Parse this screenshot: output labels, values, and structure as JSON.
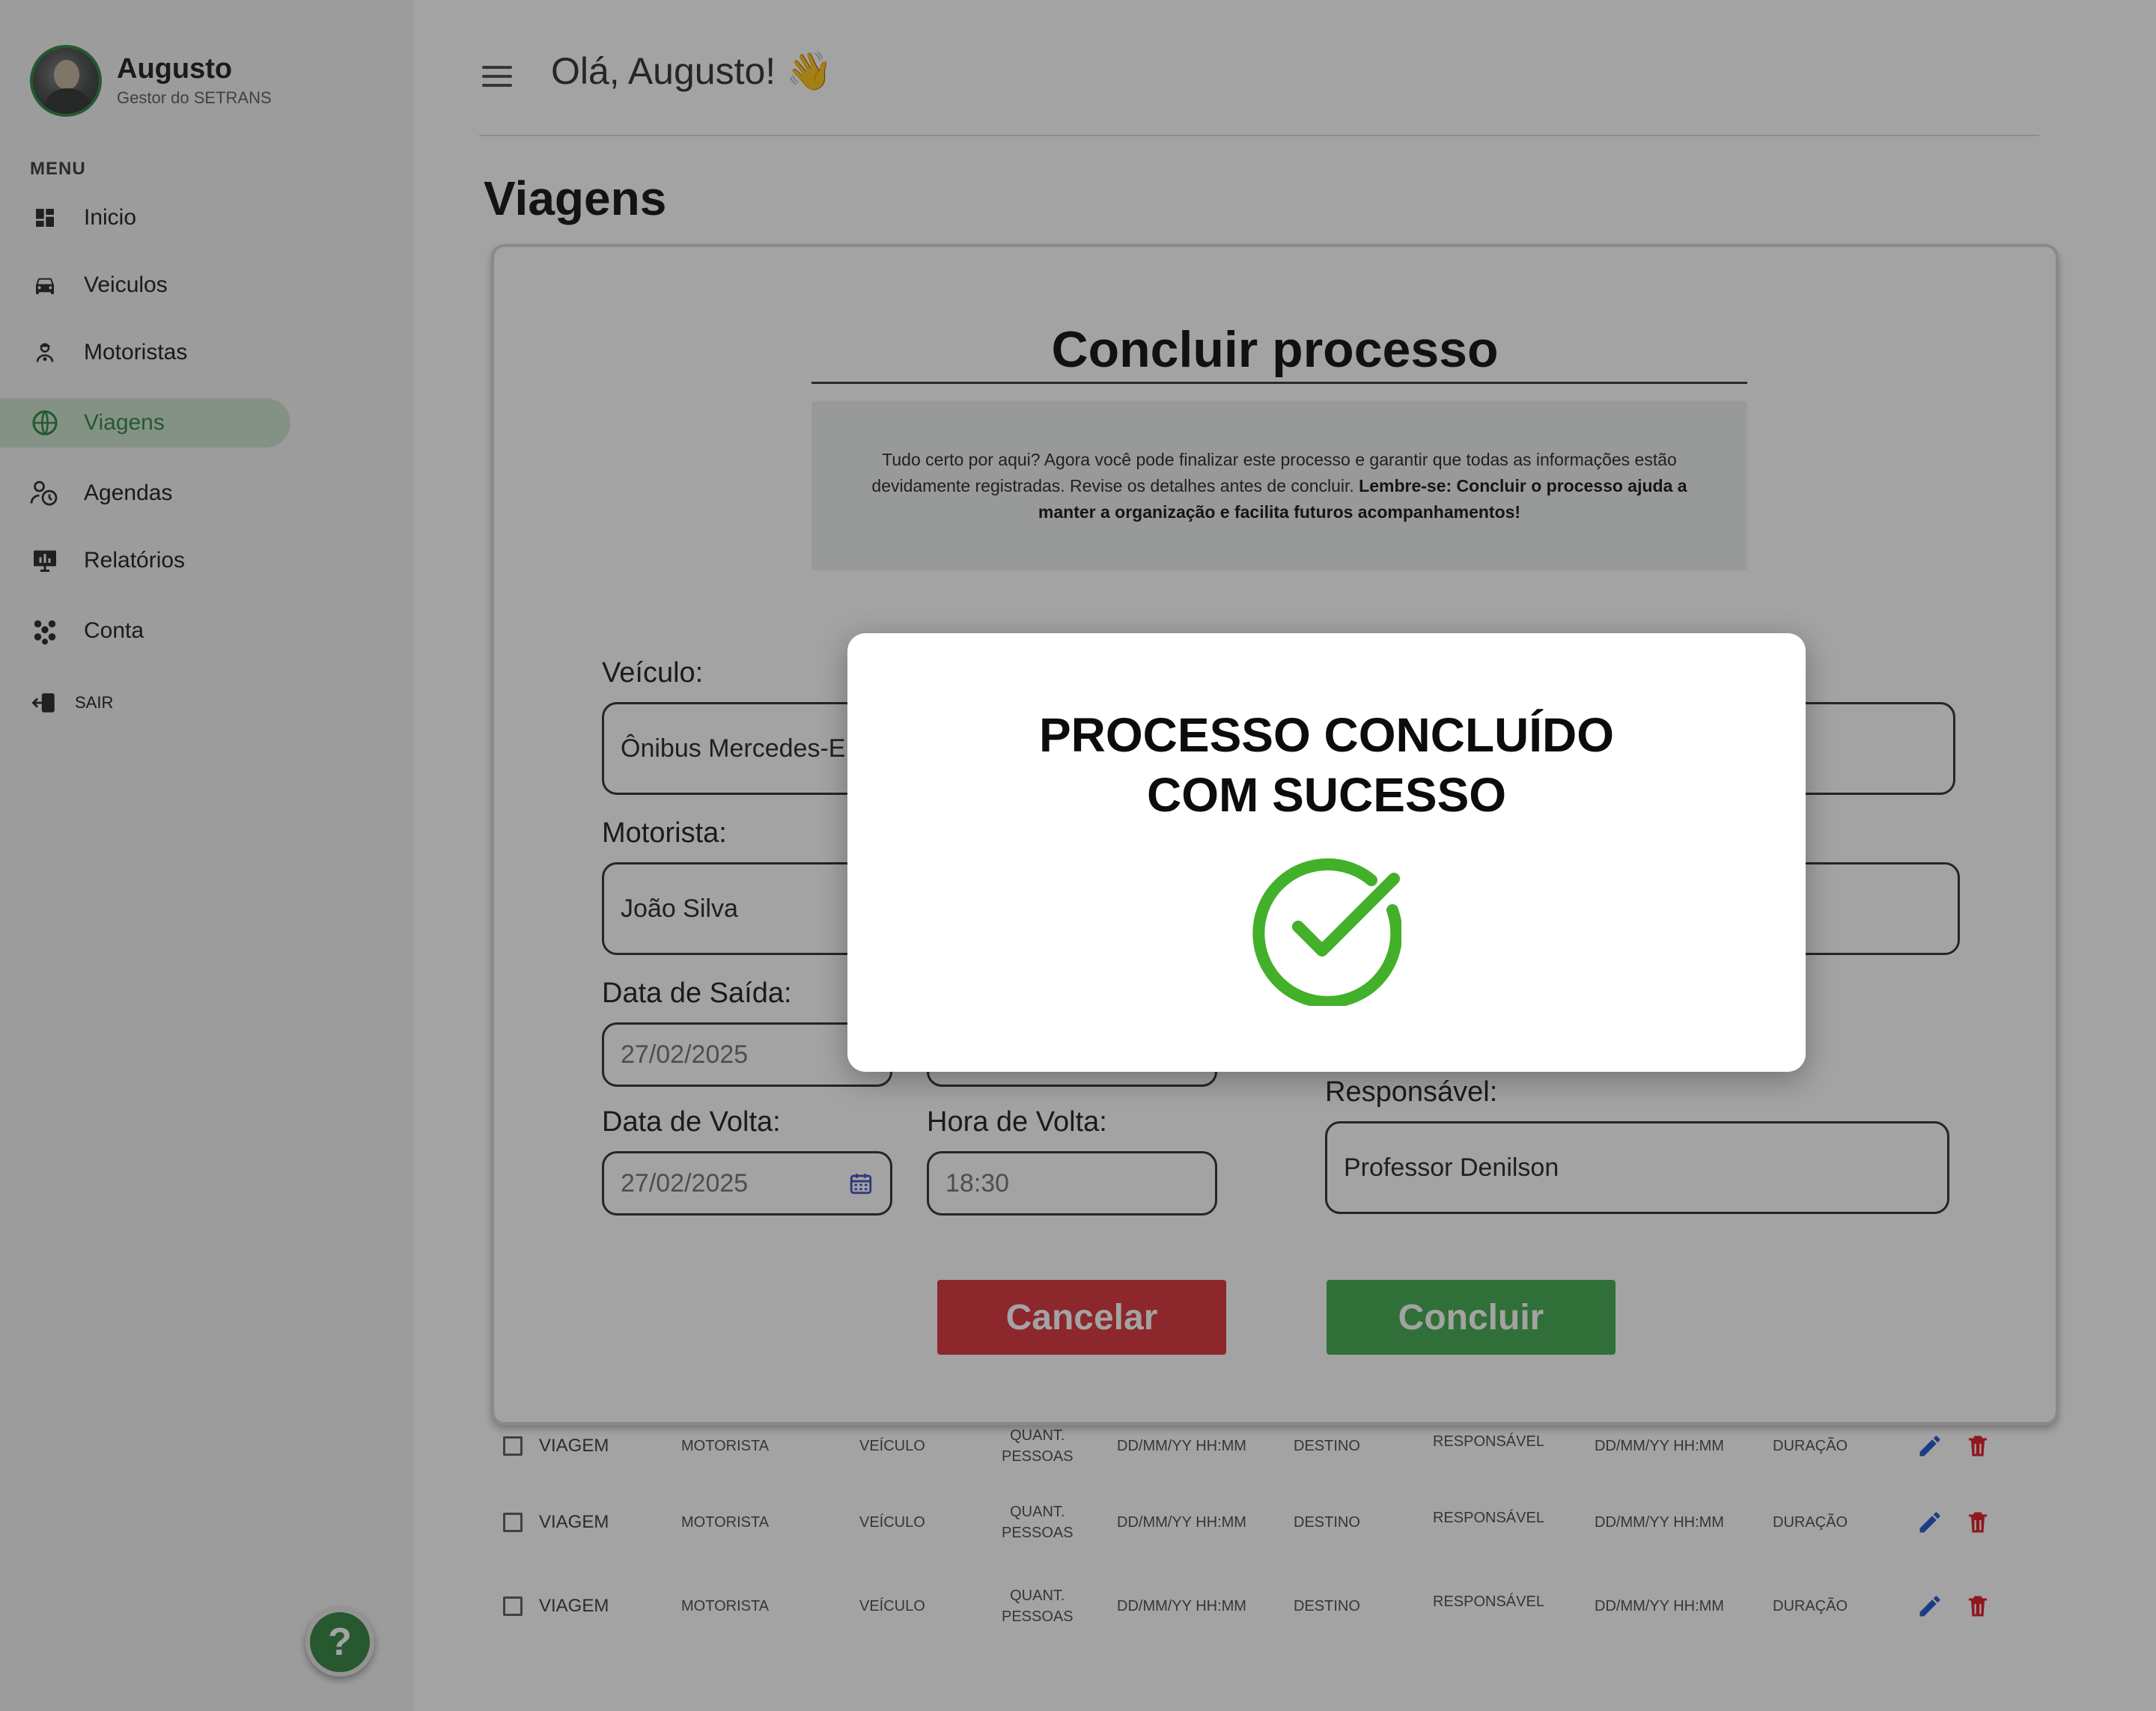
{
  "user": {
    "name": "Augusto",
    "role": "Gestor do SETRANS"
  },
  "sidebar": {
    "menu_title": "MENU",
    "items": [
      {
        "label": "Inicio",
        "icon": "dashboard-icon"
      },
      {
        "label": "Veiculos",
        "icon": "car-icon"
      },
      {
        "label": "Motoristas",
        "icon": "driver-icon"
      },
      {
        "label": "Viagens",
        "icon": "globe-icon",
        "active": true
      },
      {
        "label": "Agendas",
        "icon": "schedule-icon"
      },
      {
        "label": "Relatórios",
        "icon": "report-icon"
      },
      {
        "label": "Conta",
        "icon": "account-icon"
      }
    ],
    "logout_label": "SAIR",
    "help_label": "?"
  },
  "header": {
    "greeting": "Olá, Augusto!",
    "wave_emoji": "👋"
  },
  "page": {
    "title": "Viagens"
  },
  "form": {
    "title": "Concluir processo",
    "info_text": "Tudo certo por aqui? Agora você pode finalizar este processo e garantir que todas as informações estão devidamente registradas. Revise os detalhes antes de concluir. ",
    "info_bold": "Lembre-se: Concluir o processo ajuda a manter a organização e facilita futuros acompanhamentos!",
    "vehicle_label": "Veículo:",
    "vehicle_value": "Ônibus Mercedes-E",
    "driver_label": "Motorista:",
    "driver_value": "João Silva",
    "departure_date_label": "Data de Saída:",
    "departure_date_value": "27/02/2025",
    "return_date_label": "Data de Volta:",
    "return_date_value": "27/02/2025",
    "return_time_label": "Hora de Volta:",
    "return_time_value": "18:30",
    "responsible_label": "Responsável:",
    "responsible_value": "Professor Denilson",
    "cancel_label": "Cancelar",
    "confirm_label": "Concluir"
  },
  "table": {
    "rows": [
      {
        "viagem": "VIAGEM",
        "motorista": "MOTORISTA",
        "veiculo": "VEÍCULO",
        "quant_1": "QUANT.",
        "quant_2": "PESSOAS",
        "saida": "DD/MM/YY HH:MM",
        "destino": "DESTINO",
        "responsavel": "RESPONSÁVEL",
        "volta": "DD/MM/YY HH:MM",
        "duracao": "DURAÇÃO"
      },
      {
        "viagem": "VIAGEM",
        "motorista": "MOTORISTA",
        "veiculo": "VEÍCULO",
        "quant_1": "QUANT.",
        "quant_2": "PESSOAS",
        "saida": "DD/MM/YY HH:MM",
        "destino": "DESTINO",
        "responsavel": "RESPONSÁVEL",
        "volta": "DD/MM/YY HH:MM",
        "duracao": "DURAÇÃO"
      },
      {
        "viagem": "VIAGEM",
        "motorista": "MOTORISTA",
        "veiculo": "VEÍCULO",
        "quant_1": "QUANT.",
        "quant_2": "PESSOAS",
        "saida": "DD/MM/YY HH:MM",
        "destino": "DESTINO",
        "responsavel": "RESPONSÁVEL",
        "volta": "DD/MM/YY HH:MM",
        "duracao": "DURAÇÃO"
      }
    ]
  },
  "modal": {
    "title_line1": "PROCESSO CONCLUÍDO",
    "title_line2": "COM SUCESSO",
    "icon": "check-circle-icon"
  },
  "colors": {
    "accent_green": "#4caf58",
    "danger_red": "#dc3e44",
    "success_green": "#43b02a",
    "edit_blue": "#2f5fd0",
    "delete_red": "#e0262f"
  }
}
